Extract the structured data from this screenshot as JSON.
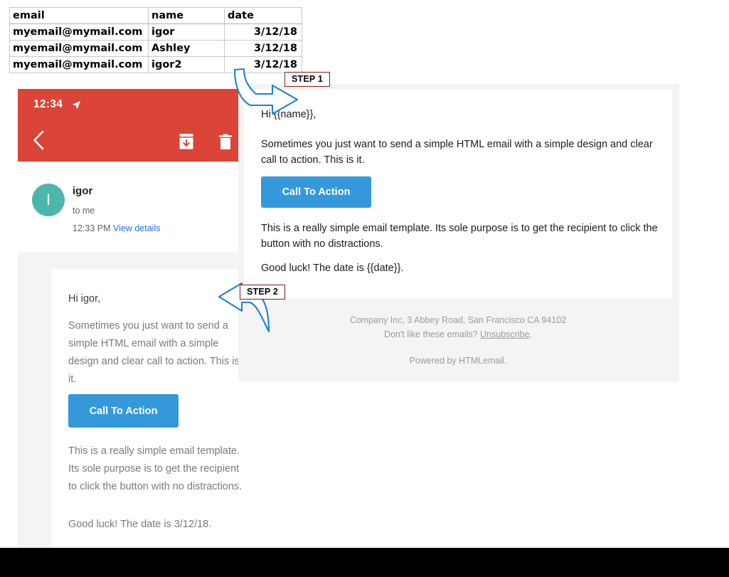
{
  "spreadsheet": {
    "headers": [
      "email",
      "name",
      "date"
    ],
    "rows": [
      {
        "email": "myemail@mymail.com",
        "name": "igor",
        "date": "3/12/18"
      },
      {
        "email": "myemail@mymail.com",
        "name": "Ashley",
        "date": "3/12/18"
      },
      {
        "email": "myemail@mymail.com",
        "name": "igor2",
        "date": "3/12/18"
      }
    ]
  },
  "annotations": {
    "step1": "STEP 1",
    "step2": "STEP 2",
    "arrow_color": "#1E7FD4",
    "badge_border_color": "#8B1A14"
  },
  "mobile": {
    "statusbar": {
      "time": "12:34",
      "location_icon": "location-arrow-icon"
    },
    "actionbar": {
      "back_icon": "back-chevron-icon",
      "archive_icon": "archive-icon",
      "delete_icon": "trash-icon"
    },
    "sender": {
      "avatar_initial": "I",
      "name": "igor",
      "recipient": "to me",
      "time": "12:33 PM",
      "details_link": "View details"
    },
    "email": {
      "greeting": "Hi igor,",
      "paragraph1": "Sometimes you just want to send a simple HTML email with a simple design and clear call to action. This is it.",
      "cta_label": "Call To Action",
      "paragraph2": "This is a really simple email template. Its sole purpose is to get the recipient to click the button with no distractions.",
      "paragraph3": "Good luck! The date is 3/12/18."
    },
    "colors": {
      "header": "#DB4437",
      "avatar": "#4DB6AC",
      "link": "#1a73e8",
      "cta": "#3498DB"
    }
  },
  "desktop": {
    "email": {
      "greeting": "Hi {{name}},",
      "paragraph1": "Sometimes you just want to send a simple HTML email with a simple design and clear call to action. This is it.",
      "cta_label": "Call To Action",
      "paragraph2": "This is a really simple email template. Its sole purpose is to get the recipient to click the button with no distractions.",
      "paragraph3": "Good luck! The date is {{date}}."
    },
    "footer": {
      "address": "Company Inc, 3 Abbey Road, San Francisco CA 94102",
      "unsubscribe_prefix": "Don't like these emails? ",
      "unsubscribe_link": "Unsubscribe",
      "unsubscribe_suffix": ".",
      "powered_by": "Powered by HTMLemail."
    },
    "colors": {
      "cta": "#3498DB",
      "background": "#f4f4f4"
    }
  }
}
